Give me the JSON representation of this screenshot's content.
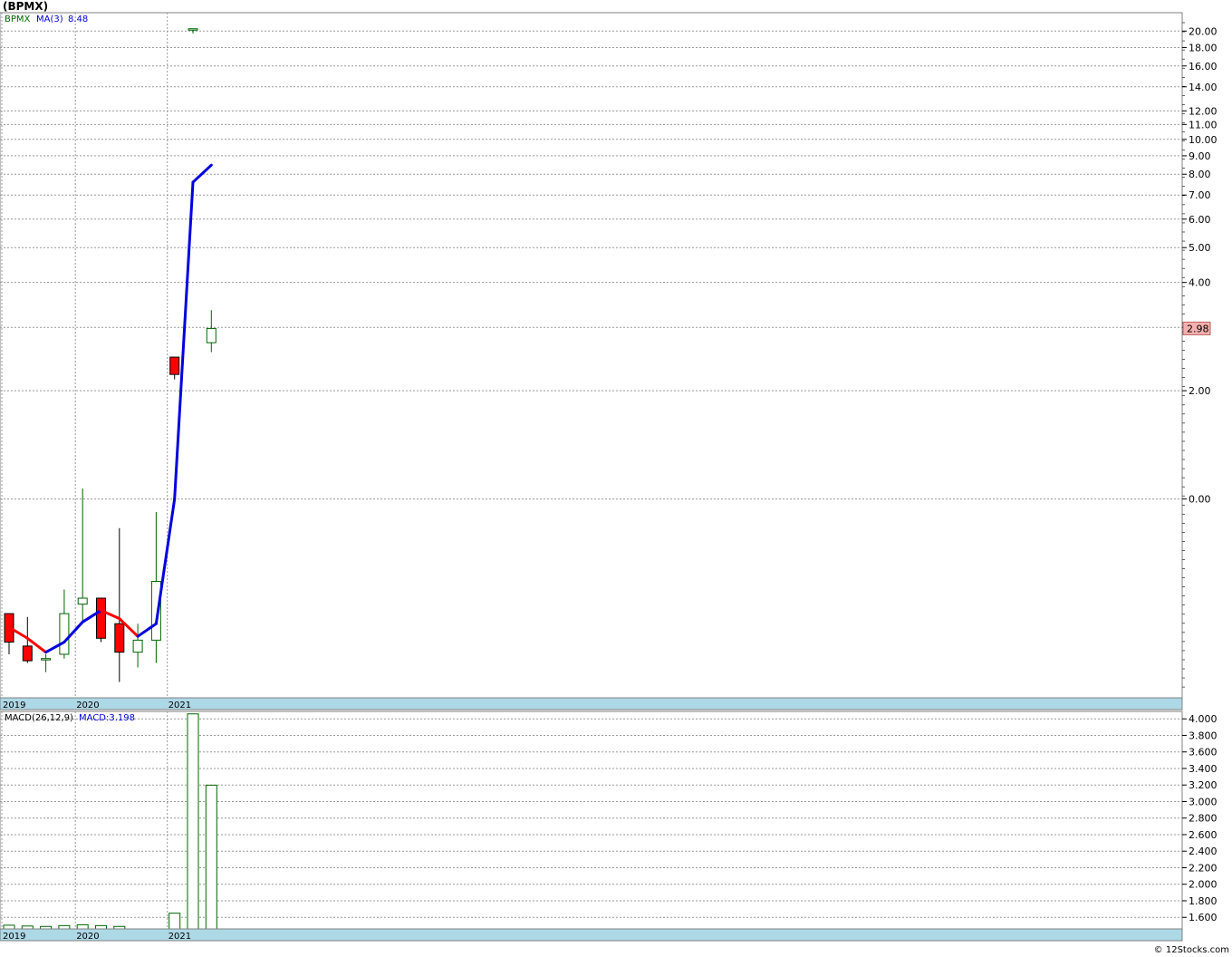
{
  "header": {
    "title": "(BPMX)",
    "legend_symbol": "BPMX",
    "legend_ma": "MA(3)",
    "legend_ma_value": "8.48",
    "macd_label": "MACD(26,12,9)",
    "macd_value_label": "MACD:3.198",
    "copyright": "© 12Stocks.com"
  },
  "colors": {
    "up_candle": "#006400",
    "down_candle": "#ff0000",
    "ma_up": "#0000dd",
    "ma_down": "#ff0000",
    "legend_symbol": "#006400",
    "legend_ma": "#0000dd",
    "year_band": "#add8e6",
    "price_badge_bg": "#f4b0b0",
    "grid": "#999999",
    "macd_bar": "#006400"
  },
  "chart_data": [
    {
      "type": "candlestick",
      "title": "(BPMX)",
      "y_scale": "log",
      "ylim": [
        0.28,
        22.5
      ],
      "grid": true,
      "y_ticks": [
        "20.00",
        "18.00",
        "16.00",
        "14.00",
        "12.00",
        "11.00",
        "10.00",
        "9.00",
        "8.00",
        "7.00",
        "6.00",
        "5.00",
        "4.00",
        "3.00",
        "2.00",
        "0.00"
      ],
      "x_tick_labels": [
        "2019",
        "2020",
        "2021"
      ],
      "last_price": "2.98",
      "candles": [
        {
          "open": 0.48,
          "high": 0.48,
          "low": 0.37,
          "close": 0.4
        },
        {
          "open": 0.39,
          "high": 0.47,
          "low": 0.35,
          "close": 0.355
        },
        {
          "open": 0.36,
          "high": 0.37,
          "low": 0.33,
          "close": 0.36
        },
        {
          "open": 0.37,
          "high": 0.56,
          "low": 0.36,
          "close": 0.48
        },
        {
          "open": 0.51,
          "high": 1.07,
          "low": 0.45,
          "close": 0.53
        },
        {
          "open": 0.53,
          "high": 0.53,
          "low": 0.4,
          "close": 0.41
        },
        {
          "open": 0.45,
          "high": 0.83,
          "low": 0.31,
          "close": 0.375
        },
        {
          "open": 0.375,
          "high": 0.45,
          "low": 0.34,
          "close": 0.405
        },
        {
          "open": 0.405,
          "high": 0.92,
          "low": 0.35,
          "close": 0.59
        },
        {
          "open": 2.48,
          "high": 2.48,
          "low": 2.15,
          "close": 2.22
        },
        {
          "open": 20.2,
          "high": 20.3,
          "low": 19.7,
          "close": 20.3
        },
        {
          "open": 2.72,
          "high": 3.35,
          "low": 2.56,
          "close": 2.98
        }
      ],
      "ma": {
        "name": "MA(3)",
        "values": [
          0.44,
          0.41,
          0.375,
          0.4,
          0.455,
          0.49,
          0.465,
          0.415,
          0.45,
          1.0,
          7.6,
          8.48
        ]
      }
    },
    {
      "type": "bar",
      "title": "MACD(26,12,9)",
      "ylim": [
        1.46,
        4.09
      ],
      "grid": true,
      "y_ticks": [
        "4.000",
        "3.800",
        "3.600",
        "3.400",
        "3.200",
        "3.000",
        "2.800",
        "2.600",
        "2.400",
        "2.200",
        "2.000",
        "1.800",
        "1.600"
      ],
      "x_tick_labels": [
        "2019",
        "2020",
        "2021"
      ],
      "values": [
        1.505,
        1.495,
        1.49,
        1.5,
        1.51,
        1.5,
        1.49,
        null,
        null,
        1.65,
        4.06,
        3.198
      ]
    }
  ]
}
